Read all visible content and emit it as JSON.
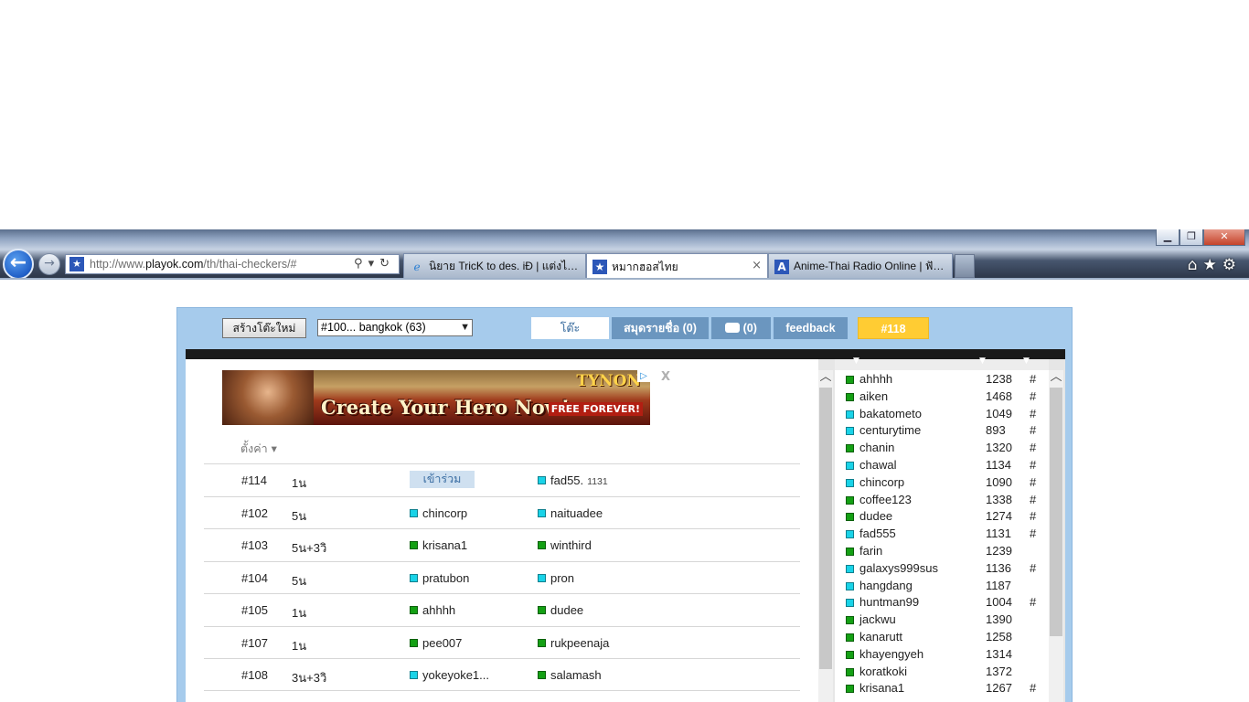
{
  "browser": {
    "address_prefix": "http://www.",
    "address_domain": "playok.com",
    "address_path": "/th/thai-checkers/#",
    "win_minimize": "▁",
    "win_restore": "❐",
    "win_close": "✕",
    "tabs": [
      {
        "title": "นิยาย TricK to des. iÐ | แต่งไอดี...",
        "icon": "ie-icon",
        "active": false
      },
      {
        "title": "หมากฮอสไทย",
        "icon": "star-favicon",
        "active": true
      },
      {
        "title": "Anime-Thai Radio Online | ฟังเ...",
        "icon": "a-favicon",
        "active": false
      }
    ],
    "tool_icons": [
      "home-icon",
      "star-icon",
      "gear-icon"
    ]
  },
  "toolbar": {
    "new_table_label": "สร้างโต๊ะใหม่",
    "room_selected": "#100... bangkok (63)",
    "tab_tables": "โต๊ะ",
    "tab_players": "สมุดรายชื่อ (0)",
    "tab_chat": "(0)",
    "tab_feedback": "feedback",
    "tab_current_table": "#118"
  },
  "ad": {
    "headline": "Create Your Hero Now!",
    "brand": "TYNON",
    "badge": "FREE FOREVER!",
    "close_label": "X"
  },
  "settings_label": "ตั้งค่า ▾",
  "join_label": "เข้าร่วม",
  "tables": [
    {
      "id": "#114",
      "time": "1น",
      "p1": null,
      "p1_color": null,
      "p2": "fad55.",
      "p2_color": "cyan",
      "p2_rating": "1131"
    },
    {
      "id": "#102",
      "time": "5น",
      "p1": "chincorp",
      "p1_color": "cyan",
      "p2": "naituadee",
      "p2_color": "cyan"
    },
    {
      "id": "#103",
      "time": "5น+3วิ",
      "p1": "krisana1",
      "p1_color": "green",
      "p2": "winthird",
      "p2_color": "green"
    },
    {
      "id": "#104",
      "time": "5น",
      "p1": "pratubon",
      "p1_color": "cyan",
      "p2": "pron",
      "p2_color": "cyan"
    },
    {
      "id": "#105",
      "time": "1น",
      "p1": "ahhhh",
      "p1_color": "green",
      "p2": "dudee",
      "p2_color": "green"
    },
    {
      "id": "#107",
      "time": "1น",
      "p1": "pee007",
      "p1_color": "green",
      "p2": "rukpeenaja",
      "p2_color": "green"
    },
    {
      "id": "#108",
      "time": "3น+3วิ",
      "p1": "yokeyoke1...",
      "p1_color": "cyan",
      "p2": "salamash",
      "p2_color": "green"
    }
  ],
  "players": [
    {
      "name": "ahhhh",
      "rating": "1238",
      "table": "#",
      "color": "green"
    },
    {
      "name": "aiken",
      "rating": "1468",
      "table": "#",
      "color": "green"
    },
    {
      "name": "bakatometo",
      "rating": "1049",
      "table": "#",
      "color": "cyan"
    },
    {
      "name": "centurytime",
      "rating": "893",
      "table": "#",
      "color": "cyan"
    },
    {
      "name": "chanin",
      "rating": "1320",
      "table": "#",
      "color": "green"
    },
    {
      "name": "chawal",
      "rating": "1134",
      "table": "#",
      "color": "cyan"
    },
    {
      "name": "chincorp",
      "rating": "1090",
      "table": "#",
      "color": "cyan"
    },
    {
      "name": "coffee123",
      "rating": "1338",
      "table": "#",
      "color": "green"
    },
    {
      "name": "dudee",
      "rating": "1274",
      "table": "#",
      "color": "green"
    },
    {
      "name": "fad555",
      "rating": "1131",
      "table": "#",
      "color": "cyan"
    },
    {
      "name": "farin",
      "rating": "1239",
      "table": "",
      "color": "green"
    },
    {
      "name": "galaxys999sus",
      "rating": "1136",
      "table": "#",
      "color": "cyan"
    },
    {
      "name": "hangdang",
      "rating": "1187",
      "table": "",
      "color": "cyan"
    },
    {
      "name": "huntman99",
      "rating": "1004",
      "table": "#",
      "color": "cyan"
    },
    {
      "name": "jackwu",
      "rating": "1390",
      "table": "",
      "color": "green"
    },
    {
      "name": "kanarutt",
      "rating": "1258",
      "table": "",
      "color": "green"
    },
    {
      "name": "khayengyeh",
      "rating": "1314",
      "table": "",
      "color": "green"
    },
    {
      "name": "koratkoki",
      "rating": "1372",
      "table": "",
      "color": "green"
    },
    {
      "name": "krisana1",
      "rating": "1267",
      "table": "#",
      "color": "green"
    }
  ],
  "colors": {
    "panel": "#a6cbec",
    "tab": "#6b96bf",
    "accent": "#ffcc33",
    "green_dot": "#14a014",
    "cyan_dot": "#19d3e8"
  }
}
